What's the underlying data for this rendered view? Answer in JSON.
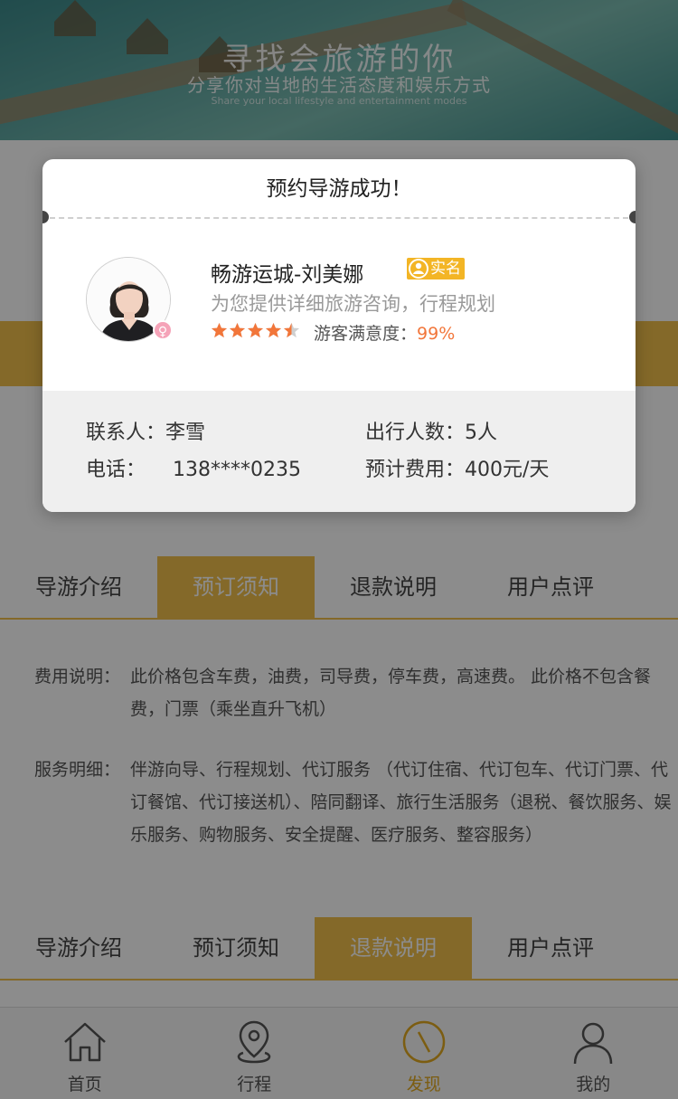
{
  "banner": {
    "title": "寻找会旅游的你",
    "subtitle": "分享你对当地的生活态度和娱乐方式",
    "subtitle_en": "Share your local lifestyle and entertainment modes"
  },
  "tabs": [
    {
      "label": "导游介绍"
    },
    {
      "label": "预订须知"
    },
    {
      "label": "退款说明"
    },
    {
      "label": "用户点评"
    }
  ],
  "notice": {
    "fee_label": "费用说明：",
    "fee_text": "此价格包含车费，油费，司导费，停车费，高速费。 此价格不包含餐费，门票（乘坐直升飞机）",
    "service_label": "服务明细：",
    "service_text": "伴游向导、行程规划、代订服务 （代订住宿、代订包车、代订门票、代订餐馆、代订接送机）、陪同翻译、旅行生活服务（退税、餐饮服务、娱乐服务、购物服务、安全提醒、医疗服务、整容服务）"
  },
  "dialog": {
    "title": "预约导游成功！",
    "guide_name": "畅游运城-刘美娜",
    "verified_badge": "实名",
    "guide_desc": "为您提供详细旅游咨询，行程规划",
    "rating": 4.5,
    "satisfaction_label": "游客满意度：",
    "satisfaction_value": "99%",
    "contact_label": "联系人：",
    "contact_value": "李雪",
    "people_label": "出行人数：",
    "people_value": "5人",
    "phone_label": "电话：",
    "phone_value": "138****0235",
    "cost_label": "预计费用：",
    "cost_value": "400元/天"
  },
  "bottom_nav": [
    {
      "label": "首页",
      "icon": "home-icon"
    },
    {
      "label": "行程",
      "icon": "location-pin-icon"
    },
    {
      "label": "发现",
      "icon": "compass-icon"
    },
    {
      "label": "我的",
      "icon": "user-icon"
    }
  ],
  "colors": {
    "accent": "#f1c04c",
    "badge": "#f3b525",
    "rating": "#f2763a",
    "nav_active": "#e2a91f"
  }
}
